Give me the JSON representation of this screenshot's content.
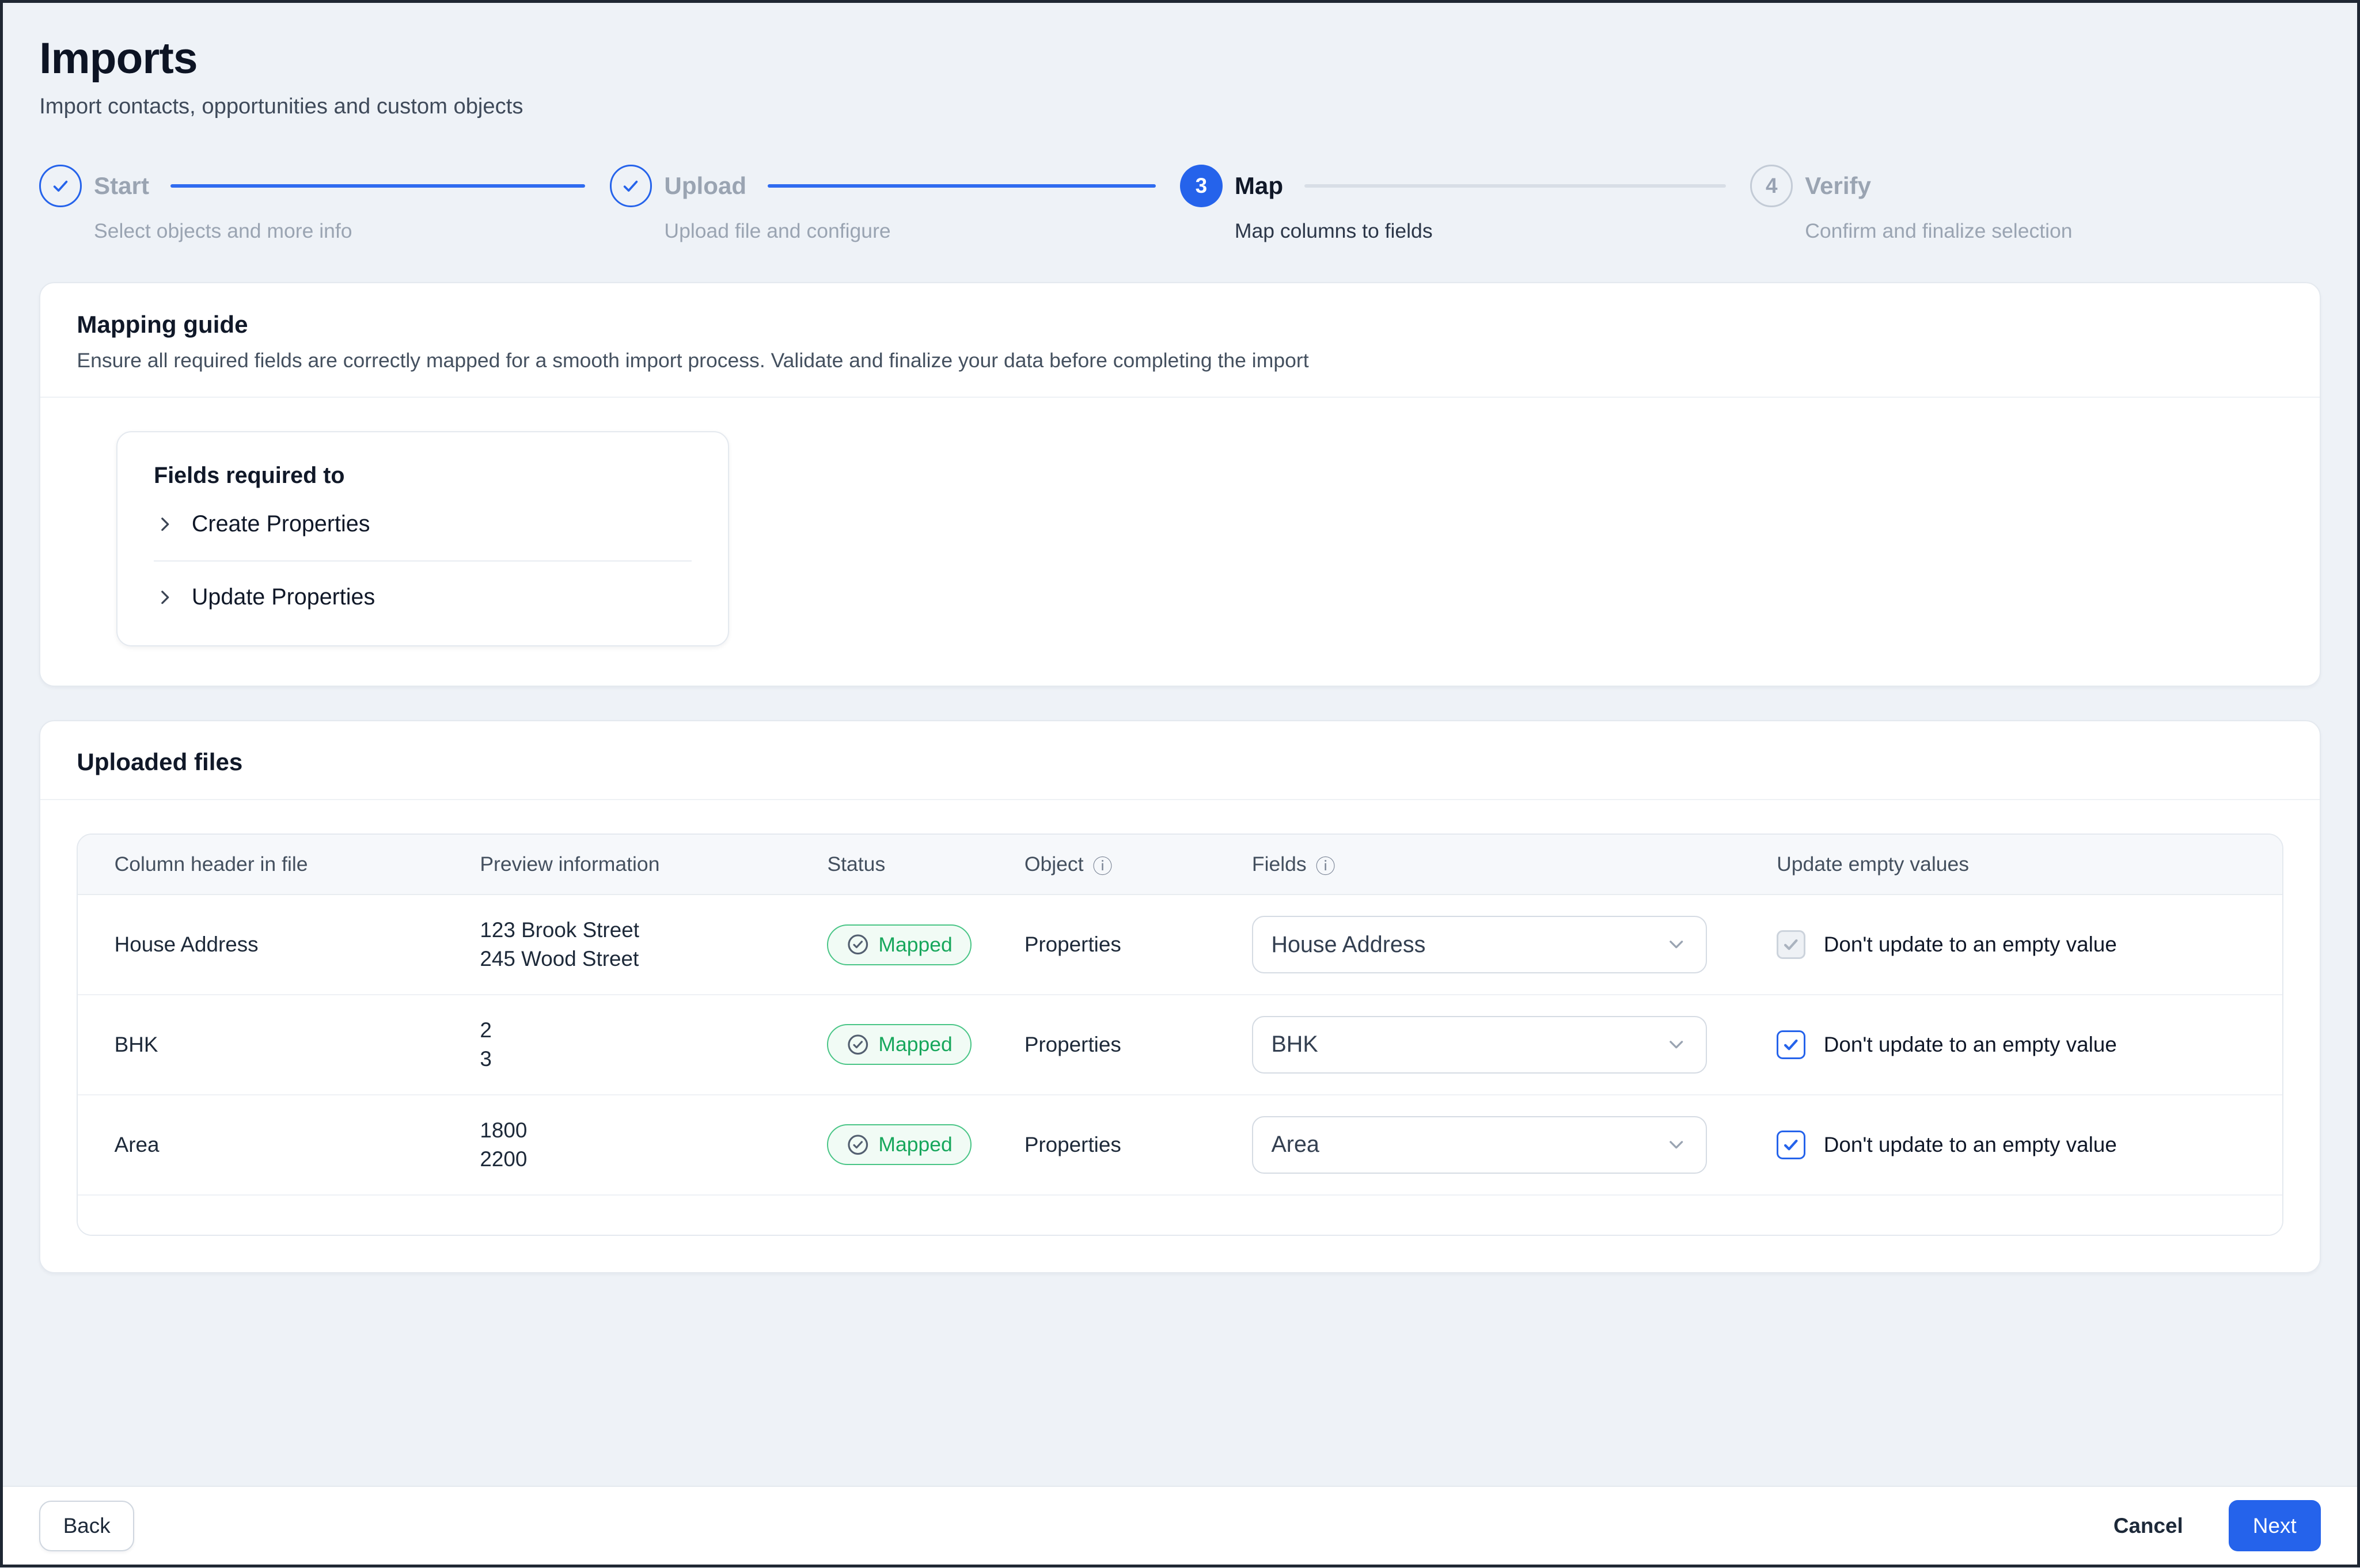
{
  "header": {
    "title": "Imports",
    "subtitle": "Import contacts, opportunities and custom objects"
  },
  "stepper": {
    "steps": [
      {
        "label": "Start",
        "description": "Select objects and more info",
        "marker": "check",
        "state": "done"
      },
      {
        "label": "Upload",
        "description": "Upload file and configure",
        "marker": "check",
        "state": "done"
      },
      {
        "label": "Map",
        "description": "Map columns to fields",
        "marker": "3",
        "state": "active"
      },
      {
        "label": "Verify",
        "description": "Confirm and finalize selection",
        "marker": "4",
        "state": "upcoming"
      }
    ]
  },
  "mapping_guide": {
    "title": "Mapping guide",
    "description": "Ensure all required fields are correctly mapped for a smooth import process. Validate and finalize your data before completing the import",
    "fields_required": {
      "title": "Fields required to",
      "items": [
        {
          "label": "Create Properties"
        },
        {
          "label": "Update Properties"
        }
      ]
    }
  },
  "uploaded_files": {
    "title": "Uploaded files",
    "table": {
      "headers": {
        "column_header": "Column header in file",
        "preview": "Preview information",
        "status": "Status",
        "object": "Object",
        "fields": "Fields",
        "update_empty": "Update empty values"
      },
      "info_icon": "ⓘ",
      "rows": [
        {
          "column_header": "House Address",
          "preview_line1": "123 Brook Street",
          "preview_line2": "245 Wood Street",
          "status": "Mapped",
          "object": "Properties",
          "field": "House Address",
          "update_empty_label": "Don't update to an empty value",
          "checkbox_checked": true,
          "checkbox_disabled": true
        },
        {
          "column_header": "BHK",
          "preview_line1": "2",
          "preview_line2": "3",
          "status": "Mapped",
          "object": "Properties",
          "field": "BHK",
          "update_empty_label": "Don't update to an empty value",
          "checkbox_checked": true,
          "checkbox_disabled": false
        },
        {
          "column_header": "Area",
          "preview_line1": "1800",
          "preview_line2": "2200",
          "status": "Mapped",
          "object": "Properties",
          "field": "Area",
          "update_empty_label": "Don't update to an empty value",
          "checkbox_checked": true,
          "checkbox_disabled": false
        }
      ]
    }
  },
  "footer": {
    "back": "Back",
    "cancel": "Cancel",
    "next": "Next"
  },
  "colors": {
    "accent": "#2563eb",
    "success_text": "#17a75c",
    "success_border": "#49c586",
    "page_background": "#eef2f7"
  }
}
